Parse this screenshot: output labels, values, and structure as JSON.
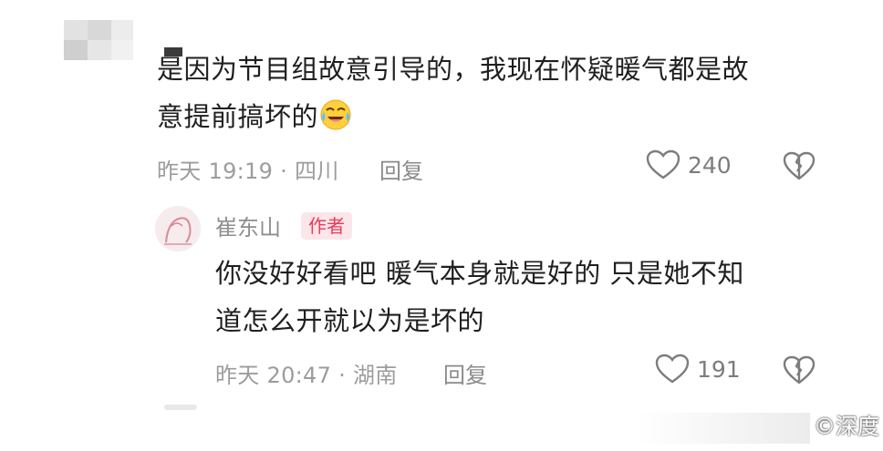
{
  "comment": {
    "text_line1": "是因为节目组故意引导的，我现在怀疑暖气都是故",
    "text_line2": "意提前搞坏的",
    "meta": "昨天 19:19 · 四川",
    "reply_label": "回复",
    "like_count": "240",
    "emoji_icon": "crying-laughing-emoji"
  },
  "reply": {
    "author_name": "崔东山",
    "author_badge": "作者",
    "text_line1": "你没好好看吧 暖气本身就是好的 只是她不知",
    "text_line2": "道怎么开就以为是坏的",
    "meta": "昨天 20:47 · 湖南",
    "reply_label": "回复",
    "like_count": "191"
  },
  "watermark": {
    "text": "©深度"
  },
  "colors": {
    "badge_text": "#f0395a",
    "badge_bg": "#fce6e9",
    "meta_gray": "#9c9c9c",
    "body_text": "#1f1f1f"
  }
}
